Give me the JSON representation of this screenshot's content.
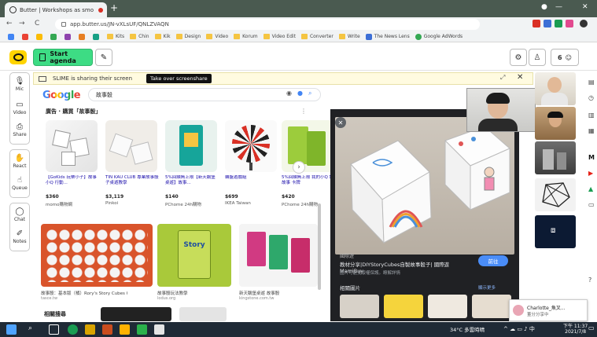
{
  "browser": {
    "tab_title": "Butter | Workshops as smo",
    "url": "app.butter.us/JN-vXLsUF/QNLZVAQN",
    "bookmarks": [
      "Kits",
      "Chin",
      "Kik",
      "Design",
      "Video",
      "Korum",
      "Video Edit",
      "Converter",
      "Write",
      "The News Lens",
      "Google AdWords"
    ]
  },
  "app": {
    "start_agenda_label": "Start agenda",
    "people_count": "6",
    "rail": [
      {
        "label": "Mic"
      },
      {
        "label": "Video"
      },
      {
        "label": "Share"
      },
      {
        "label": "React"
      },
      {
        "label": "Queue"
      },
      {
        "label": "Chat"
      },
      {
        "label": "Notes"
      }
    ],
    "share_banner": {
      "text": "SLIME is sharing their screen",
      "button": "Take over screenshare"
    }
  },
  "shared_screen": {
    "google_logo": "Google",
    "search_query": "故事骰",
    "ads_label": "廣告 · 購買「故事骰」",
    "products": [
      {
        "title": "【GoKids 玩樂小子】故事小Q 行動...",
        "price": "$360",
        "store": "momo購物網"
      },
      {
        "title": "TIN KAU CLUB 專業故事骰子桌遊教學",
        "price": "$3,119",
        "store": "Pinkoi"
      },
      {
        "title": "5%回饋無上限【新天鵝堡桌遊】故事...",
        "price": "$140",
        "store": "PChome 24h購物"
      },
      {
        "title": "轉盤遊戲組",
        "price": "$699",
        "store": "IKEA Taiwan"
      },
      {
        "title": "5%回饋無上限 我的小Q 說故事 卡牌",
        "price": "$420",
        "store": "PChome 24h購物"
      }
    ],
    "results": [
      {
        "caption": "故事骰：基本版（橘）Rory's Story Cubes Originals - G...",
        "source": "tasce.tw"
      },
      {
        "caption": "故事骰玩法教學",
        "source": "lodus.org"
      },
      {
        "caption": "新天鵝堡桌遊 故事骰",
        "source": "kingstone.com.tw"
      }
    ],
    "related_label": "相關搜尋",
    "panel": {
      "source": "國際遊",
      "title": "教材分享|DIYStoryCubes自製故事骰子| 國際遊MamiBuy",
      "subtitle": "圖片可能受版權保護。瞭解詳情",
      "visit_button": "前往",
      "related_label": "相關圖片",
      "more_label": "顯示更多"
    }
  },
  "toast": {
    "name": "Charlotte_魚叉...",
    "status": "董分分享中"
  },
  "taskbar": {
    "weather": "34°C 多雲時晴",
    "time": "下午 11:37",
    "date": "2021/7/8"
  },
  "colors": {
    "butter_yellow": "#ffd400",
    "start_green": "#3ddc84",
    "banner_bg": "#fffbe0",
    "taskbar": "#1f2a36",
    "panel_bg": "#202124"
  }
}
